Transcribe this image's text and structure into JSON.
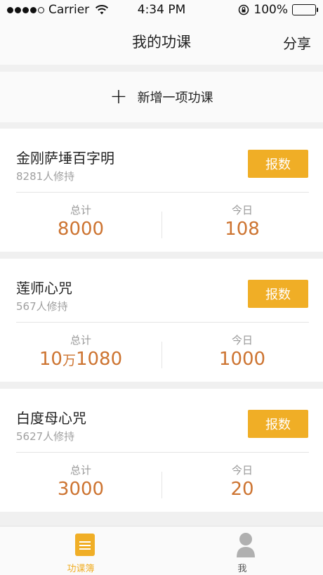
{
  "status_bar": {
    "carrier": "Carrier",
    "time": "4:34 PM",
    "battery": "100%"
  },
  "nav": {
    "title": "我的功课",
    "share": "分享"
  },
  "add_lesson": {
    "label": "新增一项功课"
  },
  "lessons": [
    {
      "name": "金刚萨埵百字明",
      "practitioners": "8281人修持",
      "report_label": "报数",
      "total_label": "总计",
      "total_value": "8000",
      "today_label": "今日",
      "today_value": "108"
    },
    {
      "name": "莲师心咒",
      "practitioners": "567人修持",
      "report_label": "报数",
      "total_label": "总计",
      "total_prefix": "10",
      "total_unit": "万",
      "total_suffix": "1080",
      "today_label": "今日",
      "today_value": "1000"
    },
    {
      "name": "白度母心咒",
      "practitioners": "5627人修持",
      "report_label": "报数",
      "total_label": "总计",
      "total_value": "3000",
      "today_label": "今日",
      "today_value": "20"
    }
  ],
  "tab_bar": {
    "items": [
      {
        "label": "功课簿",
        "icon": "book-icon",
        "active": true
      },
      {
        "label": "我",
        "icon": "person-icon",
        "active": false
      }
    ]
  },
  "colors": {
    "accent": "#f0ae26",
    "value": "#cd7431"
  }
}
